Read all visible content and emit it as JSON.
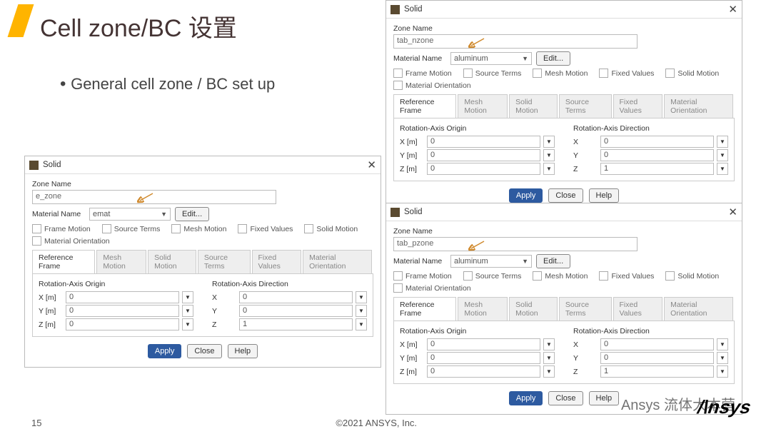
{
  "slide": {
    "title_en": "Cell zone/BC",
    "title_cn": "设置",
    "bullet": "General cell zone / BC set up",
    "page_num": "15",
    "copyright": "©2021 ANSYS, Inc.",
    "watermark": "Ansys 流体大本营",
    "logo": "/\\nsys"
  },
  "common": {
    "dlg_title": "Solid",
    "close_x": "✕",
    "zone_name_label": "Zone Name",
    "material_label": "Material Name",
    "edit_btn": "Edit...",
    "check_labels": [
      "Frame Motion",
      "Source Terms",
      "Mesh Motion",
      "Fixed Values",
      "Solid Motion",
      "Material Orientation"
    ],
    "tabs": [
      "Reference Frame",
      "Mesh Motion",
      "Solid Motion",
      "Source Terms",
      "Fixed Values",
      "Material Orientation"
    ],
    "origin_label": "Rotation-Axis Origin",
    "direction_label": "Rotation-Axis Direction",
    "axis_x": "X [m]",
    "axis_y": "Y [m]",
    "axis_z": "Z [m]",
    "apply": "Apply",
    "close": "Close",
    "help": "Help"
  },
  "dlg1": {
    "zone_name": "e_zone",
    "material": "emat",
    "ox": "0",
    "oy": "0",
    "oz": "0",
    "dx": "0",
    "dy": "0",
    "dz": "1"
  },
  "dlg2": {
    "zone_name": "tab_nzone",
    "material": "aluminum",
    "ox": "0",
    "oy": "0",
    "oz": "0",
    "dx": "0",
    "dy": "0",
    "dz": "1"
  },
  "dlg3": {
    "zone_name": "tab_pzone",
    "material": "aluminum",
    "ox": "0",
    "oy": "0",
    "oz": "0",
    "dx": "0",
    "dy": "0",
    "dz": "1"
  }
}
